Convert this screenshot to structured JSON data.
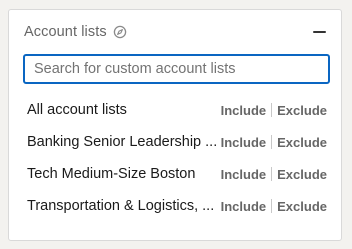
{
  "header": {
    "title": "Account lists",
    "info_icon": "compass-icon",
    "collapse_icon": "minus-icon"
  },
  "search": {
    "placeholder": "Search for custom account lists",
    "value": ""
  },
  "lists": [
    {
      "label": "All account lists",
      "include": "Include",
      "exclude": "Exclude"
    },
    {
      "label": "Banking Senior Leadership ...",
      "include": "Include",
      "exclude": "Exclude"
    },
    {
      "label": "Tech Medium-Size Boston",
      "include": "Include",
      "exclude": "Exclude"
    },
    {
      "label": "Transportation & Logistics, ...",
      "include": "Include",
      "exclude": "Exclude"
    }
  ],
  "colors": {
    "focus_border": "#0a66c2",
    "muted_text": "#666666",
    "primary_text": "#1a1a1a"
  }
}
